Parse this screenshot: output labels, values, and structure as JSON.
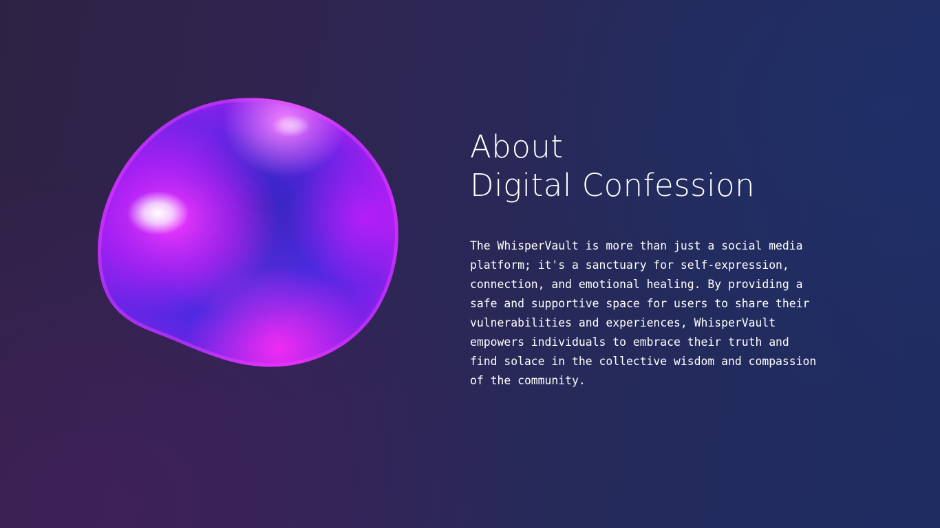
{
  "about": {
    "title_line1": "About",
    "title_line2": "Digital Confession",
    "description": "The WhisperVault is more than just a social media platform; it's a sanctuary for self-expression, connection, and emotional healing. By providing a safe and supportive space for users to share their vulnerabilities and experiences, WhisperVault empowers individuals to embrace their truth and find solace in the collective wisdom and compassion of the community."
  },
  "visual": {
    "orb_icon": "iridescent-orb",
    "colors": {
      "orb_magenta": "#e81cff",
      "orb_blue": "#3b2bd9",
      "orb_highlight": "#f4eaff",
      "text": "#ffffff"
    }
  }
}
